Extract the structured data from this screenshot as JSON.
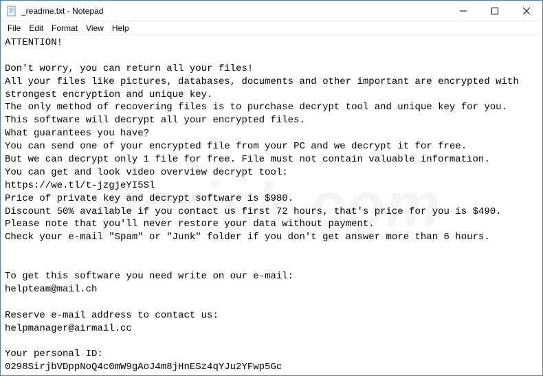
{
  "titlebar": {
    "title": "_readme.txt - Notepad"
  },
  "menubar": {
    "file": "File",
    "edit": "Edit",
    "format": "Format",
    "view": "View",
    "help": "Help"
  },
  "content": {
    "text": "ATTENTION!\n\nDon't worry, you can return all your files!\nAll your files like pictures, databases, documents and other important are encrypted with strongest encryption and unique key.\nThe only method of recovering files is to purchase decrypt tool and unique key for you.\nThis software will decrypt all your encrypted files.\nWhat guarantees you have?\nYou can send one of your encrypted file from your PC and we decrypt it for free.\nBut we can decrypt only 1 file for free. File must not contain valuable information.\nYou can get and look video overview decrypt tool:\nhttps://we.tl/t-jzgjeYI5Sl\nPrice of private key and decrypt software is $980.\nDiscount 50% available if you contact us first 72 hours, that's price for you is $490.\nPlease note that you'll never restore your data without payment.\nCheck your e-mail \"Spam\" or \"Junk\" folder if you don't get answer more than 6 hours.\n\n\nTo get this software you need write on our e-mail:\nhelpteam@mail.ch\n\nReserve e-mail address to contact us:\nhelpmanager@airmail.cc\n\nYour personal ID:\n0298SirjbVDppNoQ4c0mW9gAoJ4m8jHnESz4qYJu2YFwp5Gc"
  },
  "watermark": "pcrisk.com"
}
